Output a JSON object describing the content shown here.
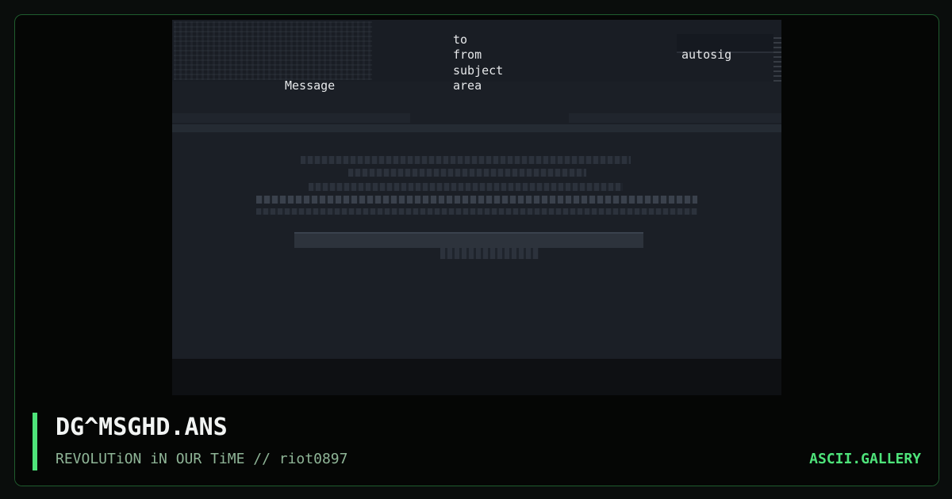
{
  "art": {
    "message_label": "Message",
    "to_label": "to",
    "from_label": "from",
    "subject_label": "subject",
    "area_label": "area",
    "autosig_label": "autosig"
  },
  "footer": {
    "title": "DG^MSGHD.ANS",
    "subtitle": "REVOLUTiON iN OUR TiME // riot0897",
    "brand": "ASCII.GALLERY"
  },
  "colors": {
    "accent": "#4ee37a",
    "border": "#1f5c2e",
    "background": "#050605",
    "art_background": "#1b1f26"
  }
}
